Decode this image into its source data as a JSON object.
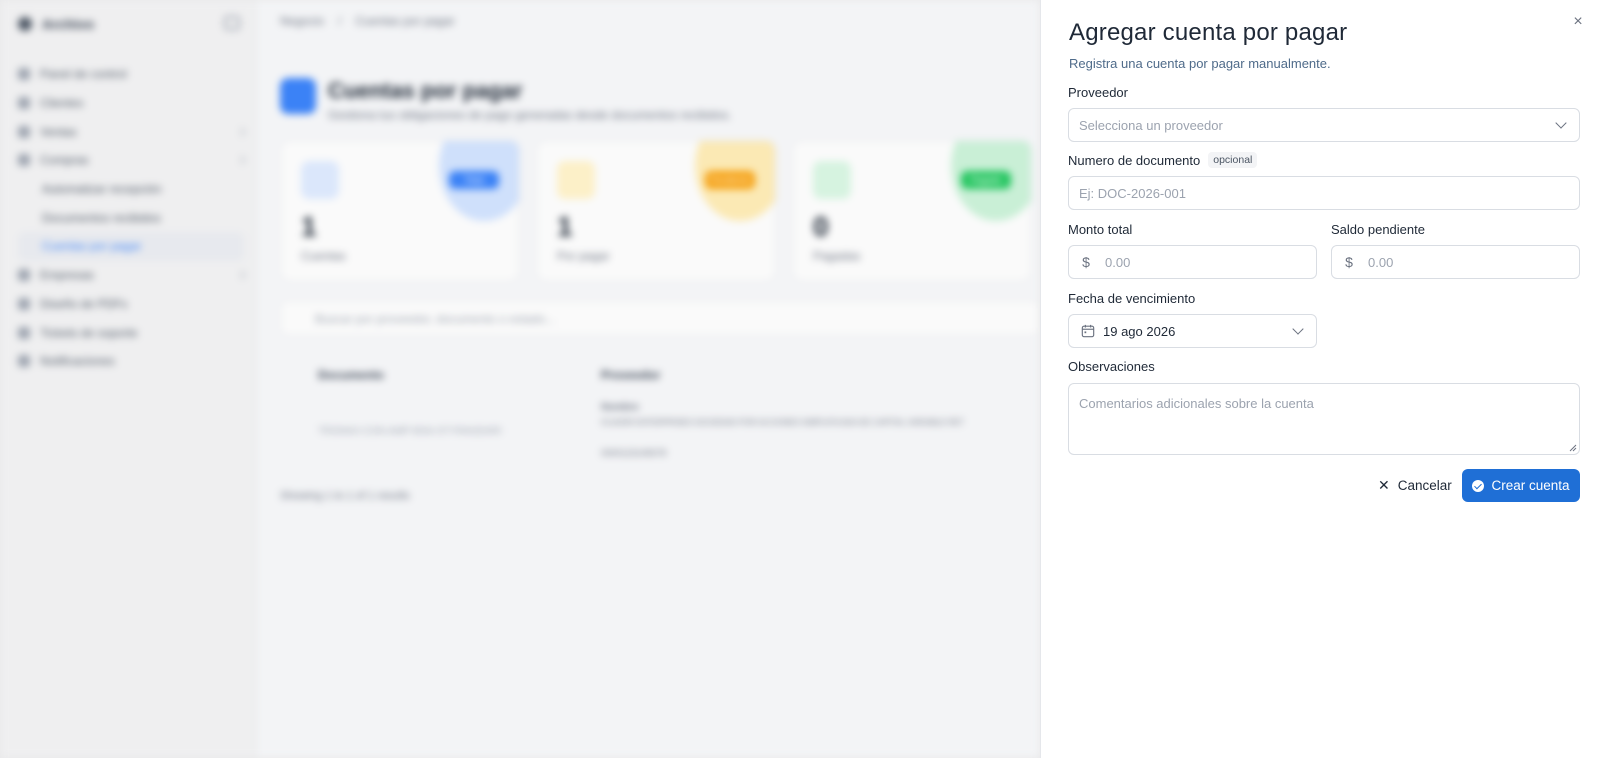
{
  "background": {
    "brand": "Archivo",
    "nav": [
      {
        "label": "Panel de control",
        "sub": false,
        "chevron": false,
        "active": false
      },
      {
        "label": "Clientes",
        "sub": false,
        "chevron": false,
        "active": false
      },
      {
        "label": "Ventas",
        "sub": false,
        "chevron": true,
        "active": false
      },
      {
        "label": "Compras",
        "sub": false,
        "chevron": true,
        "active": false
      },
      {
        "label": "Automatizar recepción",
        "sub": true,
        "chevron": false,
        "active": false
      },
      {
        "label": "Documentos recibidos",
        "sub": true,
        "chevron": false,
        "active": false
      },
      {
        "label": "Cuentas por pagar",
        "sub": true,
        "chevron": false,
        "active": true
      },
      {
        "label": "Empresas",
        "sub": false,
        "chevron": true,
        "active": false
      },
      {
        "label": "Diseño de PDFs",
        "sub": false,
        "chevron": false,
        "active": false
      },
      {
        "label": "Tickets de soporte",
        "sub": false,
        "chevron": false,
        "active": false
      },
      {
        "label": "Notificaciones",
        "sub": false,
        "chevron": false,
        "active": false
      }
    ],
    "breadcrumb": [
      "Negocio",
      "/",
      "Cuentas por pagar"
    ],
    "page_title": "Cuentas por pagar",
    "page_subtitle": "Gestiona tus obligaciones de pago generadas desde documentos recibidos.",
    "cards": [
      {
        "number": "1",
        "label": "Cuentas",
        "pill": "Total",
        "color": "#3b82f6",
        "soft": "#cfe0fb",
        "sq": "#dbe7fb"
      },
      {
        "number": "1",
        "label": "Por pagar",
        "pill": "Pendiente",
        "color": "#f59e0b",
        "soft": "#fbe9b4",
        "sq": "#fcf0c8"
      },
      {
        "number": "0",
        "label": "Pagadas",
        "pill": "Pagado",
        "color": "#22c55e",
        "soft": "#c9efd6",
        "sq": "#d6f3e0"
      }
    ],
    "search_placeholder": "Buscar por proveedor, documento o estado...",
    "table_headers": [
      "Documento",
      "Proveedor"
    ],
    "table_row": {
      "document": "TRONAX-CON-AMP-BSA-STYRAGEARI",
      "provider_title": "Nombre",
      "provider_name": "ICUADRI ENTERPRISES SOCIEDAD POR ACCIONES SIMPLIFICADA DE CAPITAL VARIABLE RET",
      "provider_id": "0000123145678"
    },
    "results": "Showing 1 to 1 of 1 results"
  },
  "panel": {
    "title": "Agregar cuenta por pagar",
    "subtitle": "Registra una cuenta por pagar manualmente.",
    "provider_label": "Proveedor",
    "provider_placeholder": "Selecciona un proveedor",
    "docnum_label": "Numero de documento",
    "optional_badge": "opcional",
    "docnum_placeholder": "Ej: DOC-2026-001",
    "total_label": "Monto total",
    "total_placeholder": "0.00",
    "balance_label": "Saldo pendiente",
    "balance_placeholder": "0.00",
    "currency_symbol": "$",
    "due_label": "Fecha de vencimiento",
    "due_value": "19 ago 2026",
    "notes_label": "Observaciones",
    "notes_placeholder": "Comentarios adicionales sobre la cuenta",
    "cancel_label": "Cancelar",
    "create_label": "Crear cuenta",
    "accent_color": "#1f6fd6"
  }
}
